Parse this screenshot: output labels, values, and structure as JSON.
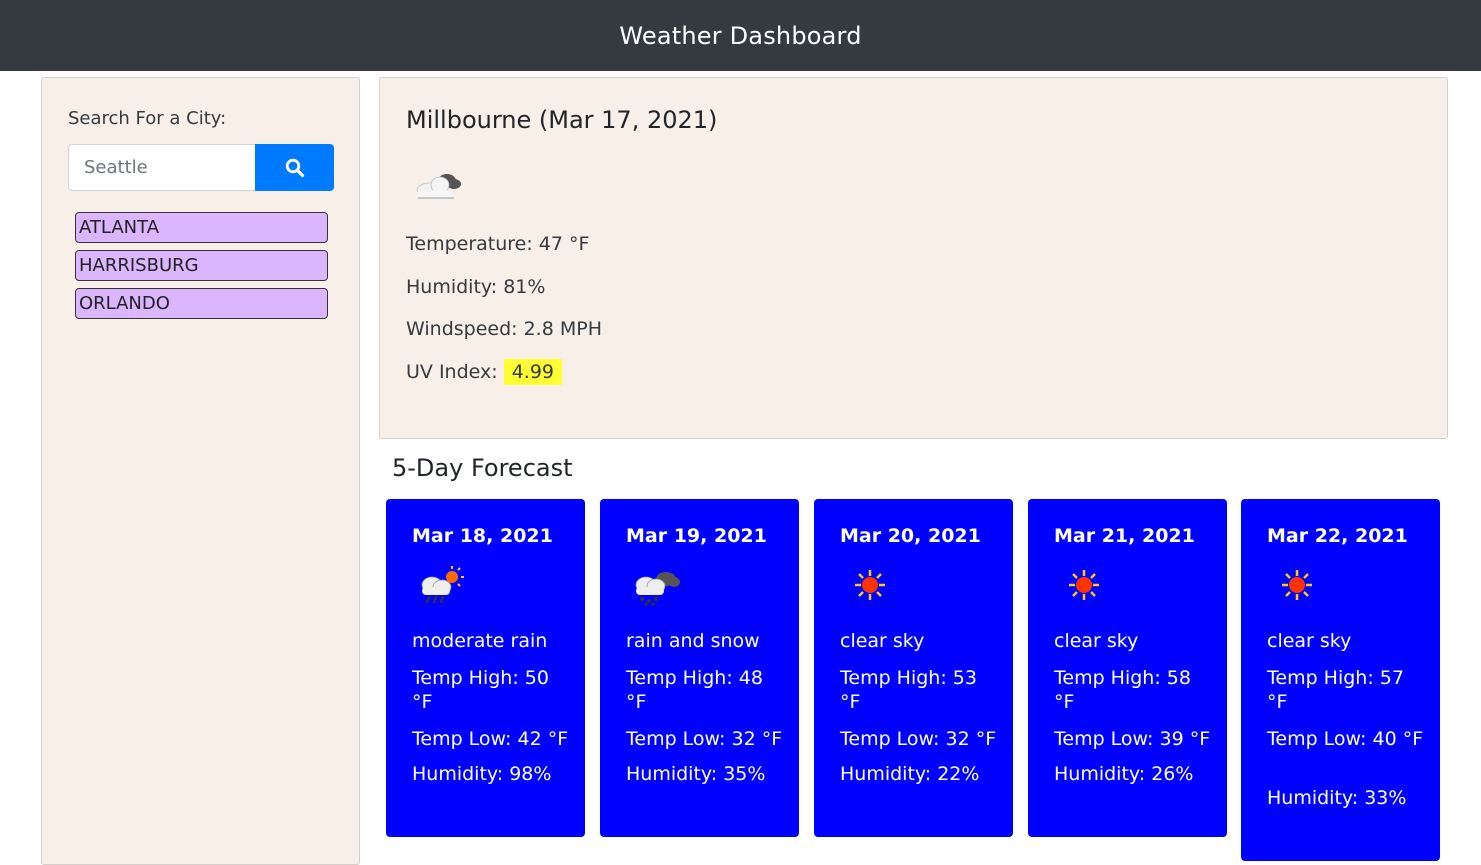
{
  "header": {
    "title": "Weather Dashboard"
  },
  "sidebar": {
    "search_label": "Search For a City:",
    "search_placeholder": "Seattle",
    "search_icon": "search-icon",
    "cities": [
      "ATLANTA",
      "HARRISBURG",
      "ORLANDO"
    ]
  },
  "current": {
    "title": "Millbourne (Mar 17, 2021)",
    "icon": "cloud-icon",
    "temperature": "Temperature: 47 °F",
    "humidity": "Humidity: 81%",
    "windspeed": "Windspeed: 2.8 MPH",
    "uv_label": "UV Index:",
    "uv_value": "4.99"
  },
  "forecast": {
    "title": "5-Day Forecast",
    "days": [
      {
        "date": "Mar 18, 2021",
        "icon": "rain-sun-icon",
        "desc": "moderate rain",
        "high": "Temp High: 50 °F",
        "low": "Temp Low: 42 °F",
        "humidity": "Humidity: 98%"
      },
      {
        "date": "Mar 19, 2021",
        "icon": "snow-cloud-icon",
        "desc": "rain and snow",
        "high": "Temp High: 48 °F",
        "low": "Temp Low: 32 °F",
        "humidity": "Humidity: 35%"
      },
      {
        "date": "Mar 20, 2021",
        "icon": "sun-icon",
        "desc": "clear sky",
        "high": "Temp High: 53 °F",
        "low": "Temp Low: 32 °F",
        "humidity": "Humidity: 22%"
      },
      {
        "date": "Mar 21, 2021",
        "icon": "sun-icon",
        "desc": "clear sky",
        "high": "Temp High: 58 °F",
        "low": "Temp Low: 39 °F",
        "humidity": "Humidity: 26%"
      },
      {
        "date": "Mar 22, 2021",
        "icon": "sun-icon",
        "desc": "clear sky",
        "high": "Temp High: 57 °F",
        "low": "Temp Low: 40 °F",
        "humidity": "Humidity: 33%"
      }
    ]
  },
  "colors": {
    "navbar": "#343a40",
    "panel": "#f8efe9",
    "search_button": "#007bff",
    "city_button": "#dbb6ff",
    "forecast_card": "#0000ff",
    "uv_highlight": "#ffff33"
  }
}
